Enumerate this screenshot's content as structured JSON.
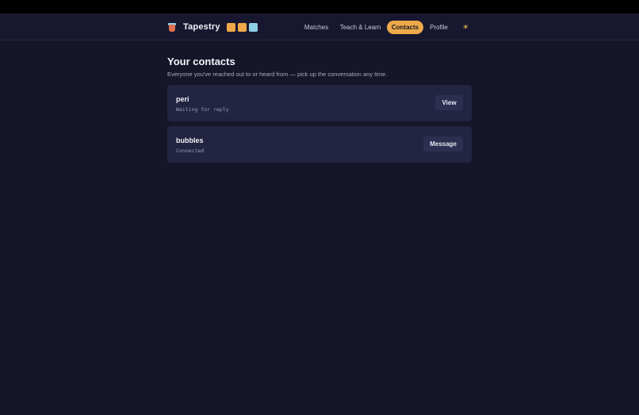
{
  "app": {
    "name": "Tapestry",
    "logo_icon": "yarn-cup-icon",
    "swatches": [
      "#eea94a",
      "#eea94a",
      "#8fd0e8"
    ]
  },
  "nav": {
    "items": [
      {
        "label": "Matches"
      },
      {
        "label": "Teach & Learn"
      },
      {
        "label": "Contacts",
        "active": true
      },
      {
        "label": "Profile"
      }
    ],
    "theme_toggle_icon": "sun-icon"
  },
  "page": {
    "title": "Your contacts",
    "subtitle": "Everyone you've reached out to or heard from — pick up the conversation any time."
  },
  "contacts": [
    {
      "name": "peri",
      "status": "Waiting for reply",
      "action": "View"
    },
    {
      "name": "bubbles",
      "status": "Connected",
      "action": "Message"
    }
  ],
  "colors": {
    "background": "#151628",
    "card": "#222442",
    "accent": "#eea94a"
  }
}
